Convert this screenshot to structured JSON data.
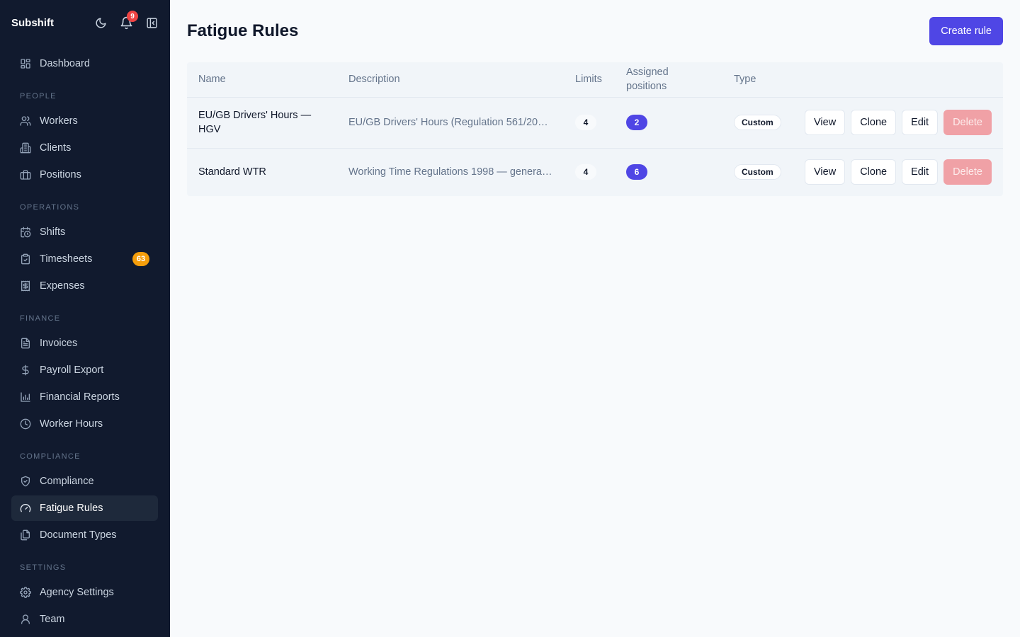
{
  "app": {
    "brand": "Subshift",
    "notification_count": "9"
  },
  "sidebar": {
    "top_items": [
      {
        "label": "Dashboard",
        "icon": "dashboard-icon"
      }
    ],
    "sections": [
      {
        "title": "PEOPLE",
        "items": [
          {
            "label": "Workers",
            "icon": "users-icon"
          },
          {
            "label": "Clients",
            "icon": "building-icon"
          },
          {
            "label": "Positions",
            "icon": "briefcase-icon"
          }
        ]
      },
      {
        "title": "OPERATIONS",
        "items": [
          {
            "label": "Shifts",
            "icon": "calendar-clock-icon"
          },
          {
            "label": "Timesheets",
            "icon": "clipboard-check-icon",
            "badge": "63"
          },
          {
            "label": "Expenses",
            "icon": "receipt-icon"
          }
        ]
      },
      {
        "title": "FINANCE",
        "items": [
          {
            "label": "Invoices",
            "icon": "file-text-icon"
          },
          {
            "label": "Payroll Export",
            "icon": "dollar-icon"
          },
          {
            "label": "Financial Reports",
            "icon": "bar-chart-icon"
          },
          {
            "label": "Worker Hours",
            "icon": "clock-icon"
          }
        ]
      },
      {
        "title": "COMPLIANCE",
        "items": [
          {
            "label": "Compliance",
            "icon": "shield-check-icon"
          },
          {
            "label": "Fatigue Rules",
            "icon": "gauge-icon",
            "active": true
          },
          {
            "label": "Document Types",
            "icon": "files-icon"
          }
        ]
      },
      {
        "title": "SETTINGS",
        "items": [
          {
            "label": "Agency Settings",
            "icon": "gear-icon"
          },
          {
            "label": "Team",
            "icon": "user-icon"
          }
        ]
      }
    ]
  },
  "page": {
    "title": "Fatigue Rules",
    "create_label": "Create rule",
    "columns": {
      "name": "Name",
      "description": "Description",
      "limits": "Limits",
      "assigned_line1": "Assigned",
      "assigned_line2": "positions",
      "type": "Type"
    },
    "actions": {
      "view": "View",
      "clone": "Clone",
      "edit": "Edit",
      "delete": "Delete"
    },
    "rows": [
      {
        "name_line1": "EU/GB Drivers' Hours —",
        "name_line2": "HGV",
        "description": "EU/GB Drivers' Hours (Regulation 561/200…",
        "limits": "4",
        "assigned": "2",
        "type": "Custom"
      },
      {
        "name_line1": "Standard WTR",
        "name_line2": "",
        "description": "Working Time Regulations 1998 — general …",
        "limits": "4",
        "assigned": "6",
        "type": "Custom"
      }
    ]
  },
  "colors": {
    "sidebar_bg": "#111a2e",
    "accent": "#4f46e5",
    "badge_orange": "#f59e0b",
    "notif_red": "#ef4444",
    "delete_disabled": "#f0a1a6"
  }
}
